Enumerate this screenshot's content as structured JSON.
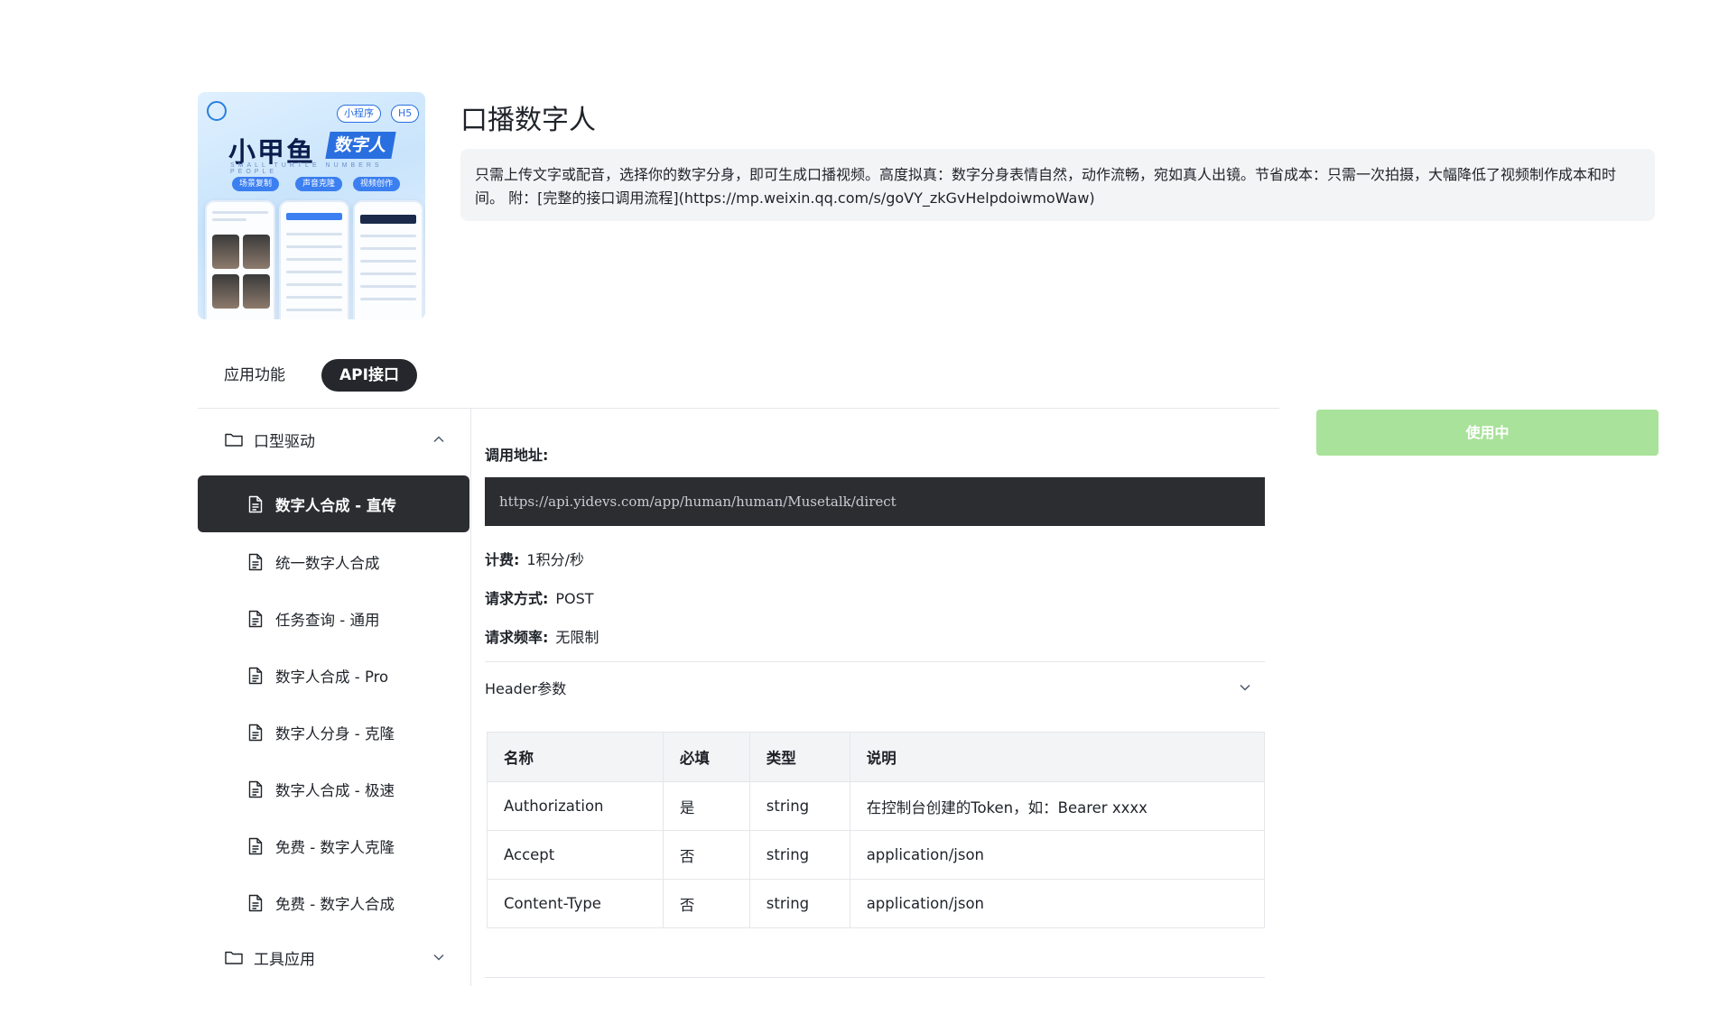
{
  "header": {
    "title": "口播数字人",
    "description": "只需上传文字或配音，选择你的数字分身，即可生成口播视频。高度拟真：数字分身表情自然，动作流畅，宛如真人出镜。节省成本：只需一次拍摄，大幅降低了视频制作成本和时间。 附：[完整的接口调用流程](https://mp.weixin.qq.com/s/goVY_zkGvHelpdoiwmoWaw)"
  },
  "cover": {
    "tag1": "小程序",
    "tag2": "H5",
    "brand_main": "小甲鱼",
    "brand_accent": "数字人",
    "brand_sub": "SMALL TURTLE NUMBERS PEOPLE",
    "pills": [
      "场景复制",
      "声音克隆",
      "视频创作"
    ]
  },
  "tabs": {
    "app": "应用功能",
    "api": "API接口"
  },
  "sidebar": {
    "group1": "口型驱动",
    "items": [
      "数字人合成 - 直传",
      "统一数字人合成",
      "任务查询 - 通用",
      "数字人合成 - Pro",
      "数字人分身 - 克隆",
      "数字人合成 - 极速",
      "免费 - 数字人克隆",
      "免费 - 数字人合成"
    ],
    "group2": "工具应用"
  },
  "api": {
    "endpoint_label": "调用地址:",
    "endpoint_url": "https://api.yidevs.com/app/human/human/Musetalk/direct",
    "billing_label": "计费:",
    "billing_value": "1积分/秒",
    "method_label": "请求方式:",
    "method_value": "POST",
    "rate_label": "请求频率:",
    "rate_value": "无限制",
    "header_params_label": "Header参数"
  },
  "table": {
    "headers": [
      "名称",
      "必填",
      "类型",
      "说明"
    ],
    "rows": [
      [
        "Authorization",
        "是",
        "string",
        "在控制台创建的Token，如：Bearer xxxx"
      ],
      [
        "Accept",
        "否",
        "string",
        "application/json"
      ],
      [
        "Content-Type",
        "否",
        "string",
        "application/json"
      ]
    ]
  },
  "action": {
    "use_button": "使用中"
  },
  "colors": {
    "active_bg": "#2b2d31",
    "use_button_bg": "#a9e29a",
    "accent_blue": "#2a6fe0"
  }
}
